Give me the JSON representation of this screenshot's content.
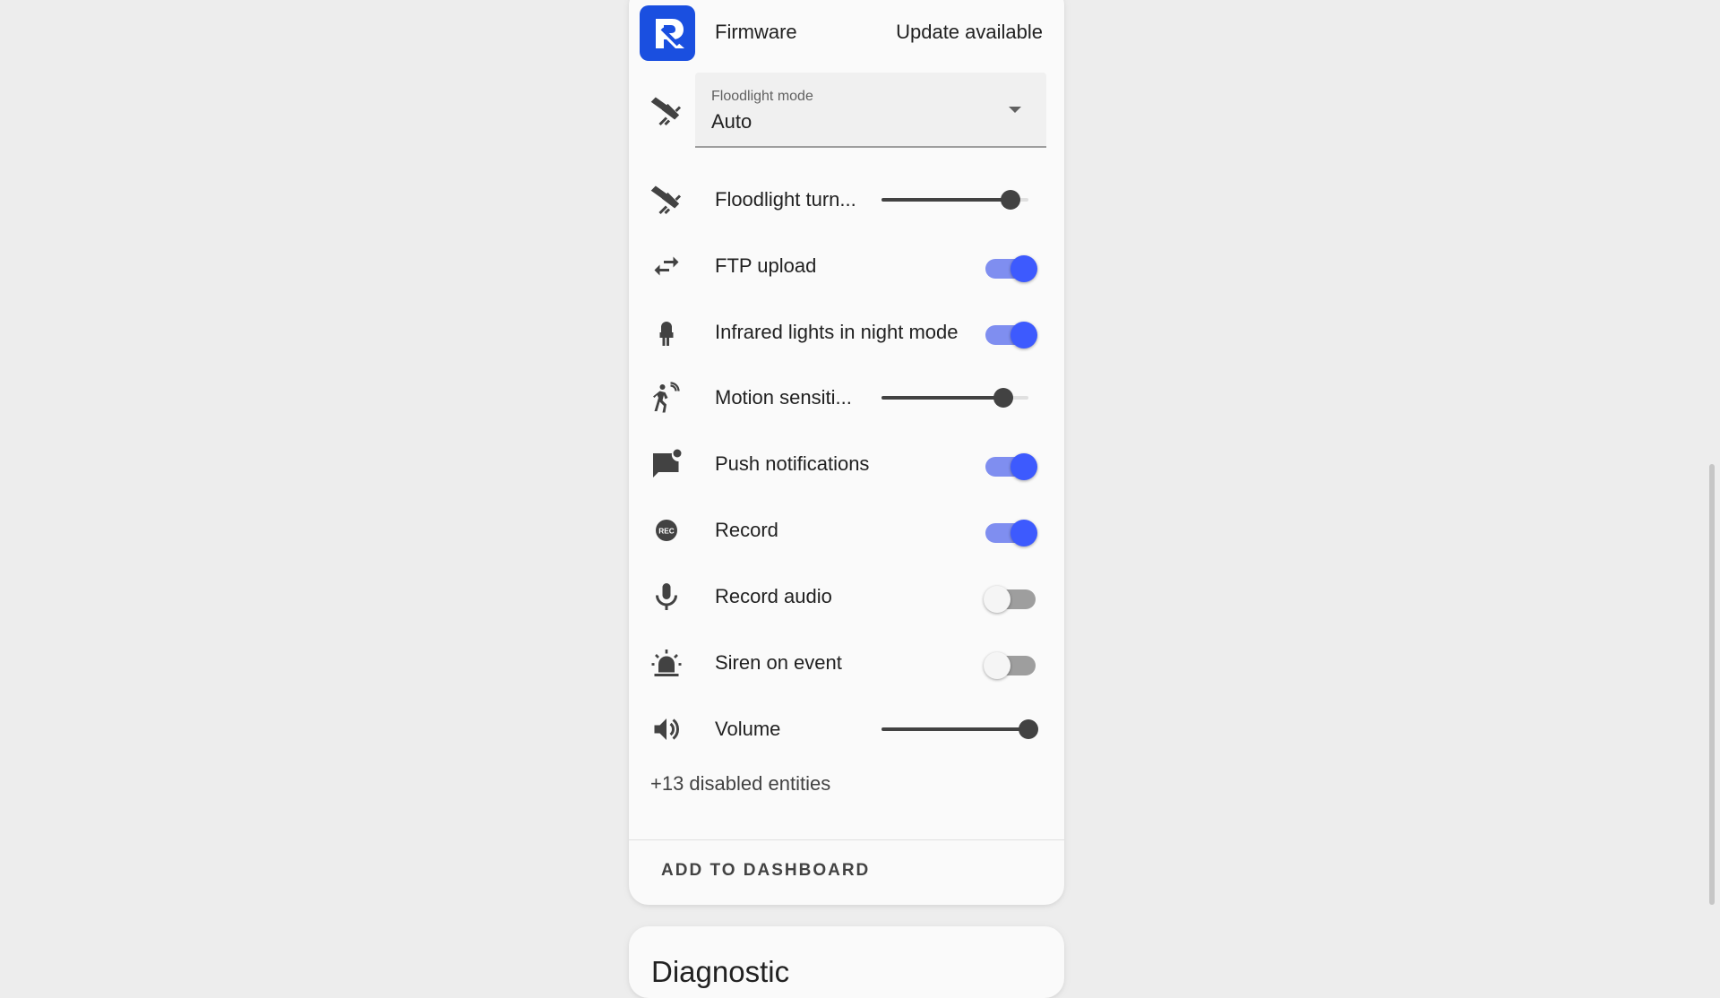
{
  "entities": {
    "firmware": {
      "label": "Firmware",
      "value": "Update available"
    },
    "floodlight_mode": {
      "label": "Floodlight mode",
      "value": "Auto"
    },
    "floodlight_turn": {
      "label": "Floodlight turn...",
      "level": 0.88
    },
    "ftp_upload": {
      "label": "FTP upload",
      "on": true
    },
    "infrared": {
      "label": "Infrared lights in night mode",
      "on": true
    },
    "motion": {
      "label": "Motion sensiti...",
      "level": 0.83
    },
    "push": {
      "label": "Push notifications",
      "on": true
    },
    "record": {
      "label": "Record",
      "on": true
    },
    "record_audio": {
      "label": "Record audio",
      "on": false
    },
    "siren": {
      "label": "Siren on event",
      "on": false
    },
    "volume": {
      "label": "Volume",
      "level": 1.0
    }
  },
  "disabled_text": "+13 disabled entities",
  "add_button": "ADD TO DASHBOARD",
  "next_card_title": "Diagnostic",
  "colors": {
    "accent": "#3d5afe",
    "brand": "#1a4fe0"
  },
  "icons": {
    "firmware": "reolink-logo-icon",
    "floodlight_mode": "spotlight-icon",
    "floodlight_turn": "spotlight-icon",
    "ftp_upload": "swap-arrows-icon",
    "infrared": "led-icon",
    "motion": "motion-sensor-icon",
    "push": "message-badge-icon",
    "record": "rec-icon",
    "record_audio": "microphone-icon",
    "siren": "alarm-light-icon",
    "volume": "volume-high-icon"
  }
}
